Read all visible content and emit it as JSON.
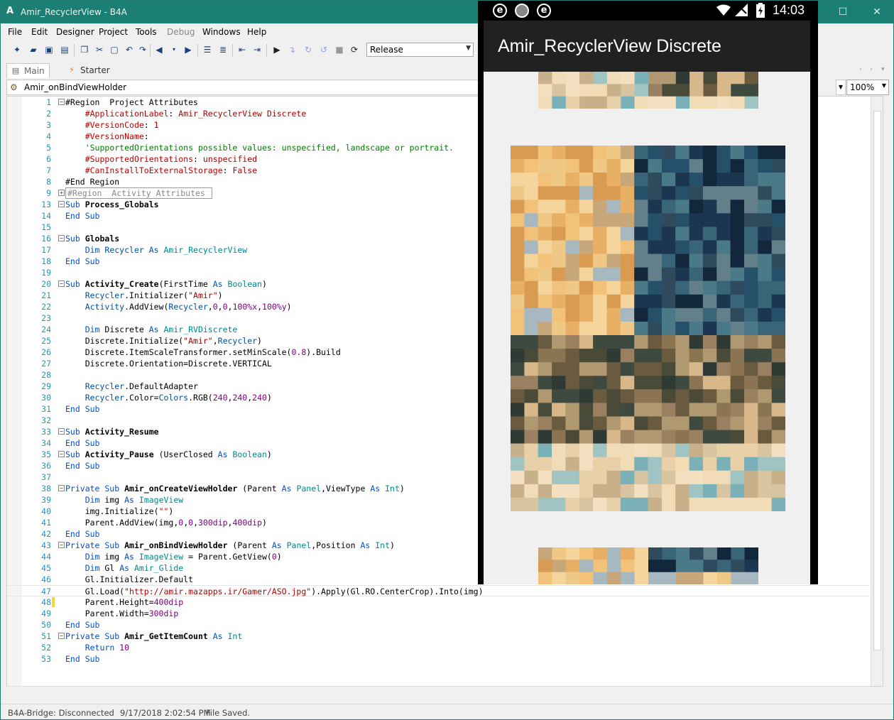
{
  "window": {
    "title": "Amir_RecyclerView - B4A",
    "app_icon": "A"
  },
  "menu": [
    "File",
    "Edit",
    "Designer",
    "Project",
    "Tools",
    "Debug",
    "Windows",
    "Help"
  ],
  "toolbar": {
    "configuration": "Release"
  },
  "tabs": [
    {
      "label": "Main",
      "active": true
    },
    {
      "label": "Starter",
      "active": false
    }
  ],
  "sub_selector": {
    "current": "Amir_onBindViewHolder"
  },
  "zoom": "100%",
  "editor": {
    "current_line": "47",
    "modified_marker_lines": [
      "48"
    ],
    "lines": [
      {
        "n": "1",
        "fold": "⊟",
        "segs": [
          [
            "",
            "#Region  Project Attributes"
          ]
        ]
      },
      {
        "n": "2",
        "segs": [
          [
            "",
            "    "
          ],
          [
            "dir",
            "#ApplicationLabel"
          ],
          [
            "",
            ": "
          ],
          [
            "str",
            "Amir_RecyclerView Discrete"
          ]
        ]
      },
      {
        "n": "3",
        "segs": [
          [
            "",
            "    "
          ],
          [
            "dir",
            "#VersionCode"
          ],
          [
            "",
            ": "
          ],
          [
            "str",
            "1"
          ]
        ]
      },
      {
        "n": "4",
        "segs": [
          [
            "",
            "    "
          ],
          [
            "dir",
            "#VersionName"
          ],
          [
            "",
            ":"
          ]
        ]
      },
      {
        "n": "5",
        "segs": [
          [
            "",
            "    "
          ],
          [
            "cm",
            "'SupportedOrientations possible values: unspecified, landscape or portrait."
          ]
        ]
      },
      {
        "n": "6",
        "segs": [
          [
            "",
            "    "
          ],
          [
            "dir",
            "#SupportedOrientations"
          ],
          [
            "",
            ": "
          ],
          [
            "str",
            "unspecified"
          ]
        ]
      },
      {
        "n": "7",
        "segs": [
          [
            "",
            "    "
          ],
          [
            "dir",
            "#CanInstallToExternalStorage"
          ],
          [
            "",
            ": "
          ],
          [
            "str",
            "False"
          ]
        ]
      },
      {
        "n": "8",
        "segs": [
          [
            "",
            "#End Region"
          ]
        ]
      },
      {
        "n": "9",
        "fold": "⊞",
        "segs": [
          [
            "collapsed",
            "#Region  Activity Attributes "
          ]
        ]
      },
      {
        "n": "13",
        "fold": "⊟",
        "segs": [
          [
            "kw",
            "Sub "
          ],
          [
            "b",
            "Process_Globals"
          ]
        ]
      },
      {
        "n": "14",
        "segs": [
          [
            "kw",
            "End Sub"
          ]
        ]
      },
      {
        "n": "15",
        "segs": []
      },
      {
        "n": "16",
        "fold": "⊟",
        "segs": [
          [
            "kw",
            "Sub "
          ],
          [
            "b",
            "Globals"
          ]
        ]
      },
      {
        "n": "17",
        "segs": [
          [
            "",
            "    "
          ],
          [
            "kw",
            "Dim "
          ],
          [
            "var",
            "Recycler"
          ],
          [
            "kw",
            " As "
          ],
          [
            "cls",
            "Amir_RecyclerView"
          ]
        ]
      },
      {
        "n": "18",
        "segs": [
          [
            "kw",
            "End Sub"
          ]
        ]
      },
      {
        "n": "19",
        "segs": []
      },
      {
        "n": "20",
        "fold": "⊟",
        "segs": [
          [
            "kw",
            "Sub "
          ],
          [
            "b",
            "Activity_Create"
          ],
          [
            "",
            "(FirstTime "
          ],
          [
            "kw",
            "As "
          ],
          [
            "cls",
            "Boolean"
          ],
          [
            "",
            ")"
          ]
        ]
      },
      {
        "n": "21",
        "segs": [
          [
            "",
            "    "
          ],
          [
            "var",
            "Recycler"
          ],
          [
            "",
            ".Initializer("
          ],
          [
            "str",
            "\"Amir\""
          ],
          [
            "",
            ")"
          ]
        ]
      },
      {
        "n": "22",
        "segs": [
          [
            "",
            "    "
          ],
          [
            "var",
            "Activity"
          ],
          [
            "",
            ".AddView("
          ],
          [
            "var",
            "Recycler"
          ],
          [
            "",
            ","
          ],
          [
            "num",
            "0"
          ],
          [
            "",
            ","
          ],
          [
            "num",
            "0"
          ],
          [
            "",
            ","
          ],
          [
            "num",
            "100%x"
          ],
          [
            "",
            ","
          ],
          [
            "num",
            "100%y"
          ],
          [
            "",
            ")"
          ]
        ]
      },
      {
        "n": "23",
        "segs": []
      },
      {
        "n": "24",
        "segs": [
          [
            "",
            "    "
          ],
          [
            "kw",
            "Dim "
          ],
          [
            "",
            "Discrete "
          ],
          [
            "kw",
            "As "
          ],
          [
            "cls",
            "Amir_RVDiscrete"
          ]
        ]
      },
      {
        "n": "25",
        "segs": [
          [
            "",
            "    Discrete.Initialize("
          ],
          [
            "str",
            "\"Amir\""
          ],
          [
            "",
            ","
          ],
          [
            "var",
            "Recycler"
          ],
          [
            "",
            ")"
          ]
        ]
      },
      {
        "n": "26",
        "segs": [
          [
            "",
            "    Discrete.ItemScaleTransformer.setMinScale("
          ],
          [
            "num",
            "0.8"
          ],
          [
            "",
            ").Build"
          ]
        ]
      },
      {
        "n": "27",
        "segs": [
          [
            "",
            "    Discrete.Orientation=Discrete.VERTICAL"
          ]
        ]
      },
      {
        "n": "28",
        "segs": []
      },
      {
        "n": "29",
        "segs": [
          [
            "",
            "    "
          ],
          [
            "var",
            "Recycler"
          ],
          [
            "",
            ".DefaultAdapter"
          ]
        ]
      },
      {
        "n": "30",
        "segs": [
          [
            "",
            "    "
          ],
          [
            "var",
            "Recycler"
          ],
          [
            "",
            ".Color="
          ],
          [
            "var",
            "Colors"
          ],
          [
            "",
            ".RGB("
          ],
          [
            "num",
            "240"
          ],
          [
            "",
            ","
          ],
          [
            "num",
            "240"
          ],
          [
            "",
            ","
          ],
          [
            "num",
            "240"
          ],
          [
            "",
            ")"
          ]
        ]
      },
      {
        "n": "31",
        "segs": [
          [
            "kw",
            "End Sub"
          ]
        ]
      },
      {
        "n": "32",
        "segs": []
      },
      {
        "n": "33",
        "fold": "⊟",
        "segs": [
          [
            "kw",
            "Sub "
          ],
          [
            "b",
            "Activity_Resume"
          ]
        ]
      },
      {
        "n": "34",
        "segs": [
          [
            "kw",
            "End Sub"
          ]
        ]
      },
      {
        "n": "35",
        "fold": "⊟",
        "segs": [
          [
            "kw",
            "Sub "
          ],
          [
            "b",
            "Activity_Pause"
          ],
          [
            "",
            " (UserClosed "
          ],
          [
            "kw",
            "As "
          ],
          [
            "cls",
            "Boolean"
          ],
          [
            "",
            ")"
          ]
        ]
      },
      {
        "n": "36",
        "segs": [
          [
            "kw",
            "End Sub"
          ]
        ]
      },
      {
        "n": "37",
        "segs": []
      },
      {
        "n": "38",
        "fold": "⊟",
        "segs": [
          [
            "kw",
            "Private Sub "
          ],
          [
            "b",
            "Amir_onCreateViewHolder"
          ],
          [
            "",
            " (Parent "
          ],
          [
            "kw",
            "As "
          ],
          [
            "cls",
            "Panel"
          ],
          [
            "",
            ",ViewType "
          ],
          [
            "kw",
            "As "
          ],
          [
            "cls",
            "Int"
          ],
          [
            "",
            ")"
          ]
        ]
      },
      {
        "n": "39",
        "segs": [
          [
            "",
            "    "
          ],
          [
            "kw",
            "Dim "
          ],
          [
            "",
            "img "
          ],
          [
            "kw",
            "As "
          ],
          [
            "cls",
            "ImageView"
          ]
        ]
      },
      {
        "n": "40",
        "segs": [
          [
            "",
            "    img.Initialize("
          ],
          [
            "str",
            "\"\""
          ],
          [
            "",
            ")"
          ]
        ]
      },
      {
        "n": "41",
        "segs": [
          [
            "",
            "    Parent.AddView(img,"
          ],
          [
            "num",
            "0"
          ],
          [
            "",
            ","
          ],
          [
            "num",
            "0"
          ],
          [
            "",
            ","
          ],
          [
            "num",
            "300dip"
          ],
          [
            "",
            ","
          ],
          [
            "num",
            "400dip"
          ],
          [
            "",
            ")"
          ]
        ]
      },
      {
        "n": "42",
        "segs": [
          [
            "kw",
            "End Sub"
          ]
        ]
      },
      {
        "n": "43",
        "fold": "⊟",
        "segs": [
          [
            "kw",
            "Private Sub "
          ],
          [
            "b",
            "Amir_onBindViewHolder"
          ],
          [
            "",
            " (Parent "
          ],
          [
            "kw",
            "As "
          ],
          [
            "cls",
            "Panel"
          ],
          [
            "",
            ",Position "
          ],
          [
            "kw",
            "As "
          ],
          [
            "cls",
            "Int"
          ],
          [
            "",
            ")"
          ]
        ]
      },
      {
        "n": "44",
        "segs": [
          [
            "",
            "    "
          ],
          [
            "kw",
            "Dim "
          ],
          [
            "",
            "img "
          ],
          [
            "kw",
            "As "
          ],
          [
            "cls",
            "ImageView"
          ],
          [
            "",
            " = Parent.GetView("
          ],
          [
            "num",
            "0"
          ],
          [
            "",
            ")"
          ]
        ]
      },
      {
        "n": "45",
        "segs": [
          [
            "",
            "    "
          ],
          [
            "kw",
            "Dim "
          ],
          [
            "",
            "Gl "
          ],
          [
            "kw",
            "As "
          ],
          [
            "cls",
            "Amir_Glide"
          ]
        ]
      },
      {
        "n": "46",
        "segs": [
          [
            "",
            "    Gl.Initializer.Default"
          ]
        ]
      },
      {
        "n": "47",
        "segs": [
          [
            "",
            "    Gl.Load("
          ],
          [
            "str",
            "\"http://amir.mazapps.ir/Gamer/ASO.jpg\""
          ],
          [
            "",
            ").Apply(Gl.RO.CenterCrop).Into(img)"
          ]
        ]
      },
      {
        "n": "48",
        "segs": [
          [
            "",
            "    Parent.Height="
          ],
          [
            "num",
            "400dip"
          ]
        ]
      },
      {
        "n": "49",
        "segs": [
          [
            "",
            "    Parent.Width="
          ],
          [
            "num",
            "300dip"
          ]
        ]
      },
      {
        "n": "50",
        "segs": [
          [
            "kw",
            "End Sub"
          ]
        ]
      },
      {
        "n": "51",
        "fold": "⊟",
        "segs": [
          [
            "kw",
            "Private Sub "
          ],
          [
            "b",
            "Amir_GetItemCount"
          ],
          [
            "kw",
            " As "
          ],
          [
            "cls",
            "Int"
          ]
        ]
      },
      {
        "n": "52",
        "segs": [
          [
            "",
            "    "
          ],
          [
            "kw",
            "Return "
          ],
          [
            "num",
            "10"
          ]
        ]
      },
      {
        "n": "53",
        "segs": [
          [
            "kw",
            "End Sub"
          ]
        ]
      }
    ]
  },
  "status": {
    "bridge": "B4A-Bridge: Disconnected",
    "timestamp": "9/17/2018 2:02:54 PM",
    "message": "File Saved."
  },
  "device": {
    "time": "14:03",
    "app_title": "Amir_RecyclerView Discrete",
    "status_icons": [
      "e",
      "",
      "e"
    ],
    "background": "#f0f0f0"
  },
  "icons": {
    "window_controls": [
      "minimize-icon",
      "maximize-icon",
      "close-icon"
    ]
  }
}
